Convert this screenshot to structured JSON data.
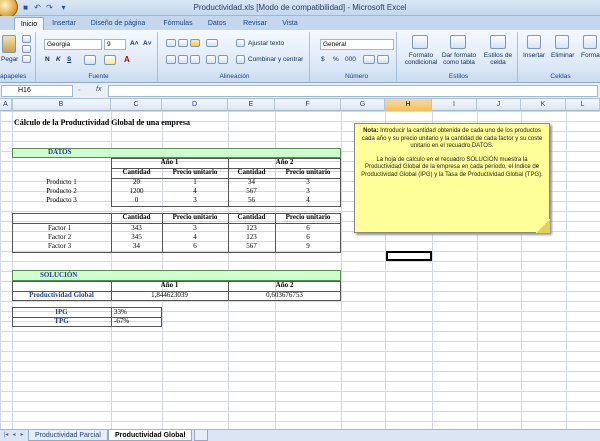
{
  "window": {
    "title": "Productividad.xls  [Modo de compatibilidad] - Microsoft Excel"
  },
  "ribbon_tabs": [
    "Inicio",
    "Insertar",
    "Diseño de página",
    "Fórmulas",
    "Datos",
    "Revisar",
    "Vista"
  ],
  "ribbon": {
    "clipboard": {
      "paste": "Pegar",
      "label": "apapeles"
    },
    "font": {
      "name": "Georgia",
      "size": "9",
      "label": "Fuente",
      "bold": "N",
      "italic": "K",
      "underline": "S"
    },
    "alignment": {
      "wrap": "Ajustar texto",
      "merge": "Combinar y centrar",
      "label": "Alineación"
    },
    "number": {
      "format": "General",
      "currency": "$",
      "percent": "%",
      "thousands": "000",
      "label": "Número"
    },
    "styles": {
      "conditional": "Formato condicional",
      "table": "Dar formato como tabla",
      "cell": "Estilos de celda",
      "label": "Estilos"
    },
    "cells": {
      "insert": "Insertar",
      "delete": "Eliminar",
      "format": "Forma",
      "label": "Celdas"
    }
  },
  "formula_bar": {
    "name_box": "H16",
    "fx": "fx",
    "formula": ""
  },
  "columns": [
    "A",
    "B",
    "C",
    "D",
    "E",
    "F",
    "G",
    "H",
    "I",
    "J",
    "K",
    "L"
  ],
  "selected_column": "H",
  "sheet": {
    "heading": "Cálculo de la Productividad Global de una empresa",
    "datos_label": "DATOS",
    "year1": "Año 1",
    "year2": "Año 2",
    "col_cantidad": "Cantidad",
    "col_precio": "Precio unitario",
    "products": [
      {
        "name": "Producto 1",
        "q1": "20",
        "p1": "1",
        "q2": "34",
        "p2": "3"
      },
      {
        "name": "Producto 2",
        "q1": "1200",
        "p1": "4",
        "q2": "567",
        "p2": "3"
      },
      {
        "name": "Producto 3",
        "q1": "0",
        "p1": "3",
        "q2": "56",
        "p2": "4"
      }
    ],
    "factors": [
      {
        "name": "Factor 1",
        "q1": "343",
        "p1": "3",
        "q2": "123",
        "p2": "6"
      },
      {
        "name": "Factor 2",
        "q1": "345",
        "p1": "4",
        "q2": "123",
        "p2": "6"
      },
      {
        "name": "Factor 3",
        "q1": "34",
        "p1": "6",
        "q2": "567",
        "p2": "9"
      }
    ],
    "solucion_label": "SOLUCIÓN",
    "pg_label": "Productividad Global",
    "pg_year1": "1,844623039",
    "pg_year2": "0,603676753",
    "ipg_label": "IPG",
    "ipg_value": "33%",
    "tpg_label": "TPG",
    "tpg_value": "-67%"
  },
  "note": {
    "bold": "Nota:",
    "text1": " Introducir la cantidad obtenida de cada uno de los productos cada año y su precio unitario y la cantidad de cada factor y su coste unitario en el recuadro DATOS.",
    "text2": "La hoja de cálculo en el recuadro SOLUCIÓN muestra la Productividad Global de la empresa en cada período, el Indice de Productividad Global (IPG) y la Tasa de Productividad Global (TPG)."
  },
  "sheet_tabs": [
    "Productividad Parcial",
    "Productividad Global"
  ],
  "active_sheet": "Productividad Global"
}
